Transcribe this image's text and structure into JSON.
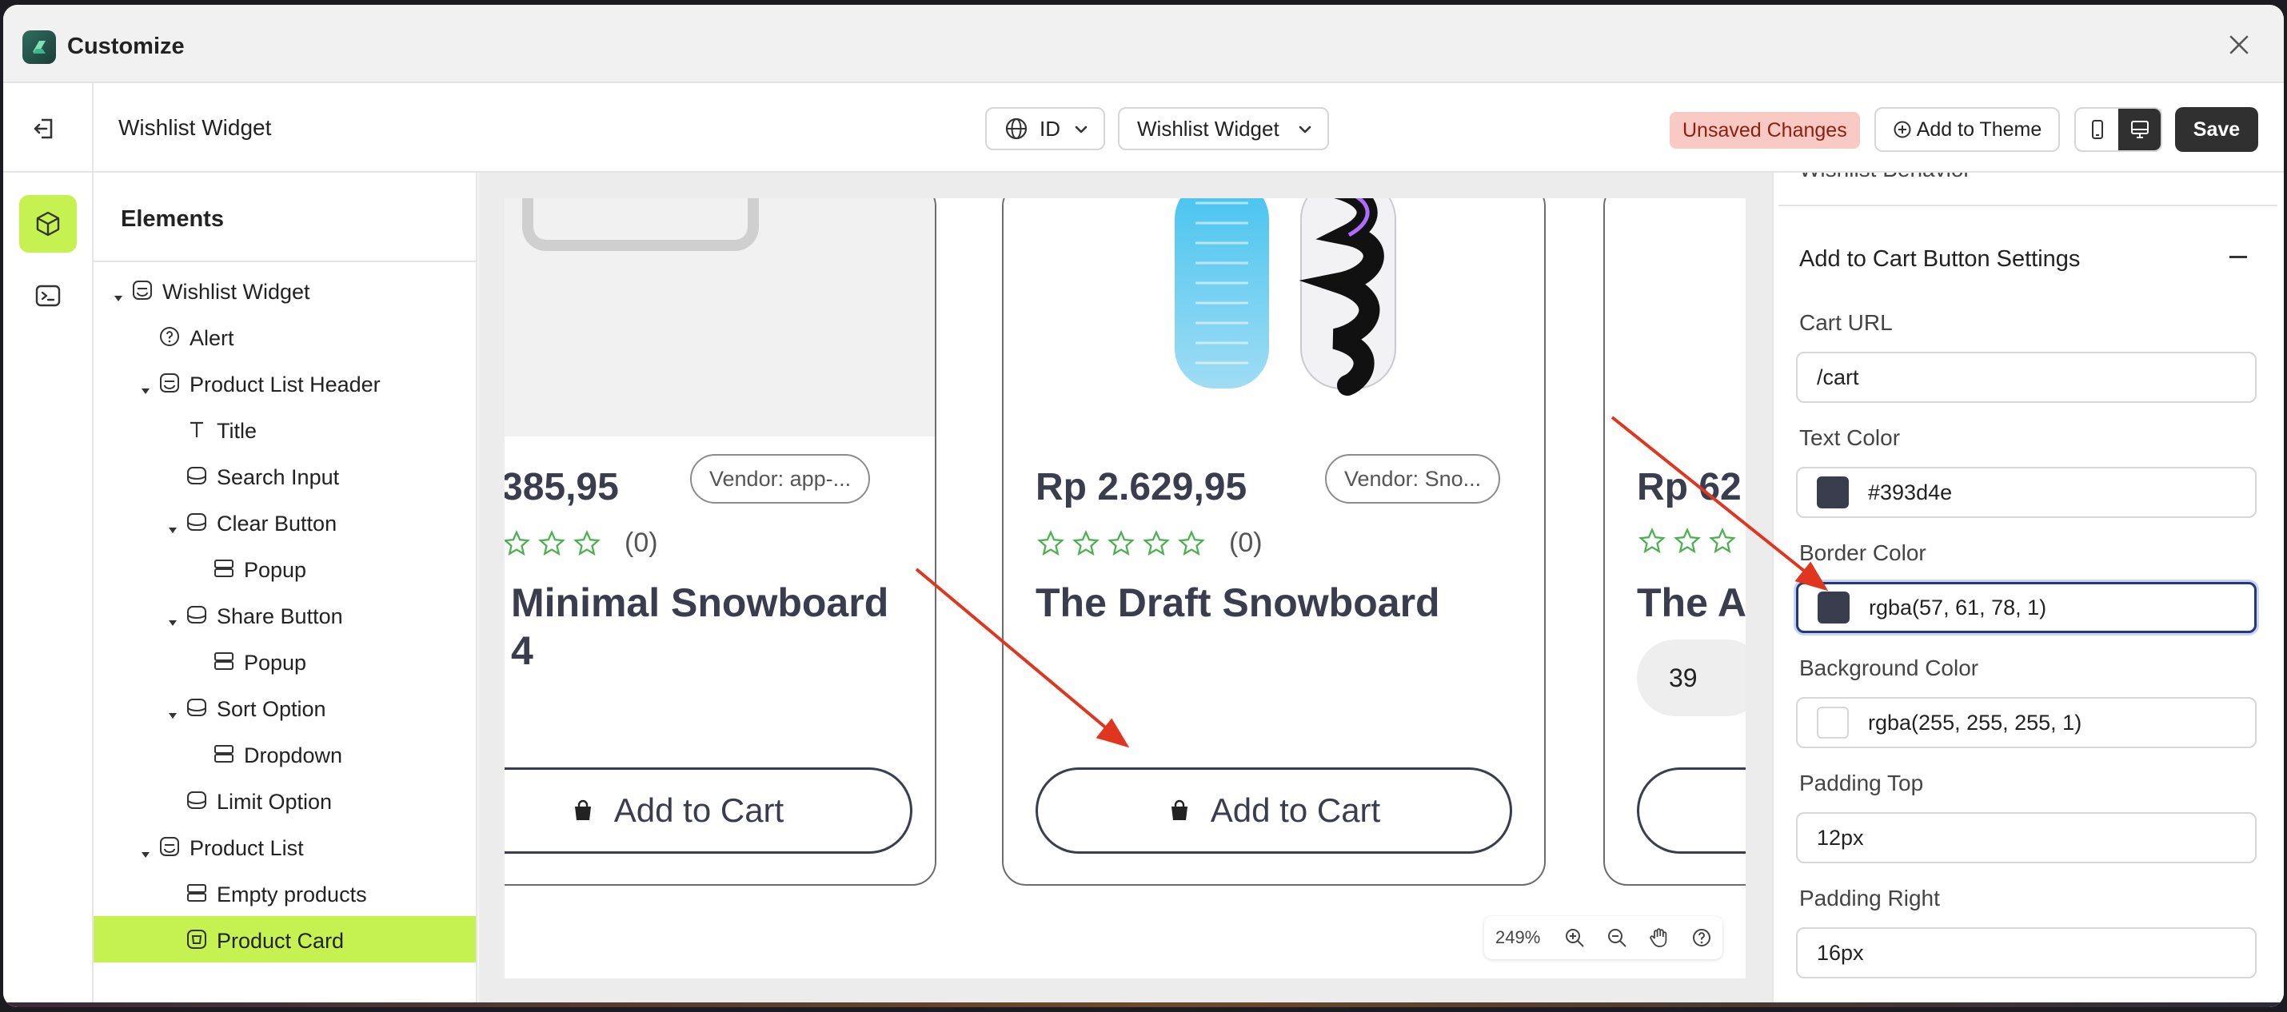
{
  "app": {
    "title": "Customize",
    "brand_color": "#2f6e5f"
  },
  "header": {
    "page_name": "Wishlist Widget",
    "language": "ID",
    "widget_select": "Wishlist Widget",
    "unsaved": "Unsaved Changes",
    "add_to_theme": "Add to Theme",
    "save": "Save",
    "accent": "#c6f251"
  },
  "elements": {
    "title": "Elements",
    "tree": [
      {
        "label": "Wishlist Widget",
        "icon": "section-icon",
        "level": 0,
        "expanded": true
      },
      {
        "label": "Alert",
        "icon": "help-circle-icon",
        "level": 1
      },
      {
        "label": "Product List Header",
        "icon": "section-icon",
        "level": 1,
        "expanded": true
      },
      {
        "label": "Title",
        "icon": "text-icon",
        "level": 2
      },
      {
        "label": "Search Input",
        "icon": "block-icon",
        "level": 2
      },
      {
        "label": "Clear Button",
        "icon": "block-icon",
        "level": 2,
        "expanded": true
      },
      {
        "label": "Popup",
        "icon": "layout-rows-icon",
        "level": 3
      },
      {
        "label": "Share Button",
        "icon": "block-icon",
        "level": 2,
        "expanded": true
      },
      {
        "label": "Popup",
        "icon": "layout-rows-icon",
        "level": 3
      },
      {
        "label": "Sort Option",
        "icon": "block-icon",
        "level": 2,
        "expanded": true
      },
      {
        "label": "Dropdown",
        "icon": "layout-rows-icon",
        "level": 3
      },
      {
        "label": "Limit Option",
        "icon": "block-icon",
        "level": 2
      },
      {
        "label": "Product List",
        "icon": "section-icon",
        "level": 1,
        "expanded": true
      },
      {
        "label": "Empty products",
        "icon": "layout-rows-icon",
        "level": 2
      },
      {
        "label": "Product Card",
        "icon": "card-icon",
        "level": 2,
        "selected": true
      }
    ]
  },
  "canvas": {
    "zoom": "249%",
    "cards": [
      {
        "price": "385,95",
        "vendor": "Vendor: app-...",
        "reviews": "(0)",
        "name_line1": " Minimal Snowboard",
        "name_line2": "4",
        "button": "Add to Cart"
      },
      {
        "price": "Rp 2.629,95",
        "vendor": "Vendor: Sno...",
        "reviews": "(0)",
        "name_line1": "The Draft Snowboard",
        "name_line2": "",
        "button": "Add to Cart"
      },
      {
        "price": "Rp 62",
        "reviews": "",
        "name_line1": "The Ar",
        "quantity": "39"
      }
    ],
    "text_color": "#393d4e",
    "star_color": "#4caf50"
  },
  "settings": {
    "clipped_header": "Wishlist Behavior",
    "section_title": "Add to Cart Button Settings",
    "fields": {
      "cart_url_label": "Cart URL",
      "cart_url_value": "/cart",
      "text_color_label": "Text Color",
      "text_color_value": "#393d4e",
      "border_color_label": "Border Color",
      "border_color_value": "rgba(57, 61, 78, 1)",
      "bg_color_label": "Background Color",
      "bg_color_value": "rgba(255, 255, 255, 1)",
      "padding_top_label": "Padding Top",
      "padding_top_value": "12px",
      "padding_right_label": "Padding Right",
      "padding_right_value": "16px"
    },
    "swatches": {
      "text": "#393d4e",
      "border": "#393d4e",
      "background": "#ffffff"
    }
  },
  "annotation_color": "#e0361f"
}
